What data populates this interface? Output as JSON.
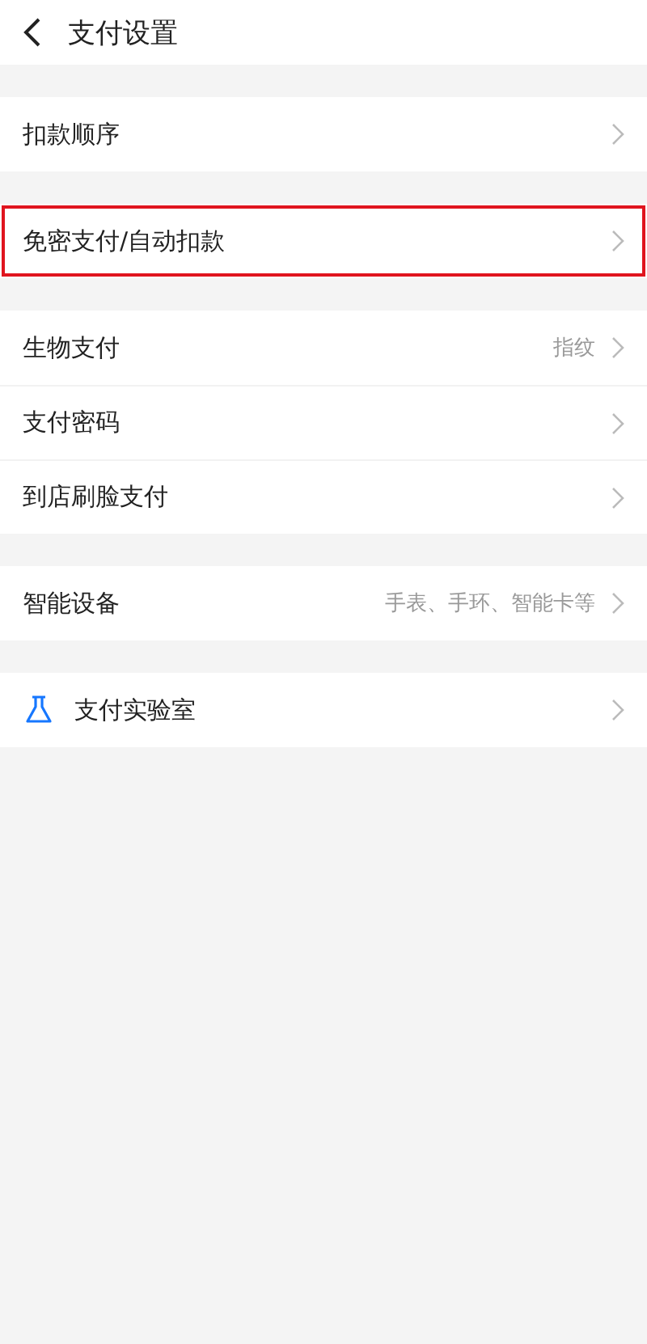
{
  "header": {
    "title": "支付设置"
  },
  "groups": [
    {
      "rows": [
        {
          "label": "扣款顺序",
          "highlighted": false
        }
      ]
    },
    {
      "rows": [
        {
          "label": "免密支付/自动扣款",
          "highlighted": true
        }
      ]
    },
    {
      "rows": [
        {
          "label": "生物支付",
          "value": "指纹",
          "highlighted": false
        },
        {
          "label": "支付密码",
          "highlighted": false
        },
        {
          "label": "到店刷脸支付",
          "highlighted": false
        }
      ]
    },
    {
      "rows": [
        {
          "label": "智能设备",
          "value": "手表、手环、智能卡等",
          "highlighted": false
        }
      ]
    },
    {
      "rows": [
        {
          "label": "支付实验室",
          "kind": "icon",
          "highlighted": false
        }
      ]
    }
  ]
}
